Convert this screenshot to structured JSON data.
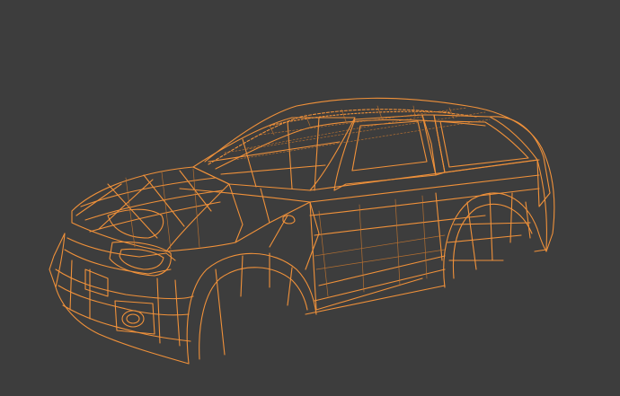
{
  "viewport": {
    "background": "#3d3d3d",
    "object": "car-body-wireframe",
    "wire_color": "#f0913a",
    "wire_color_dim": "#c9782f"
  }
}
